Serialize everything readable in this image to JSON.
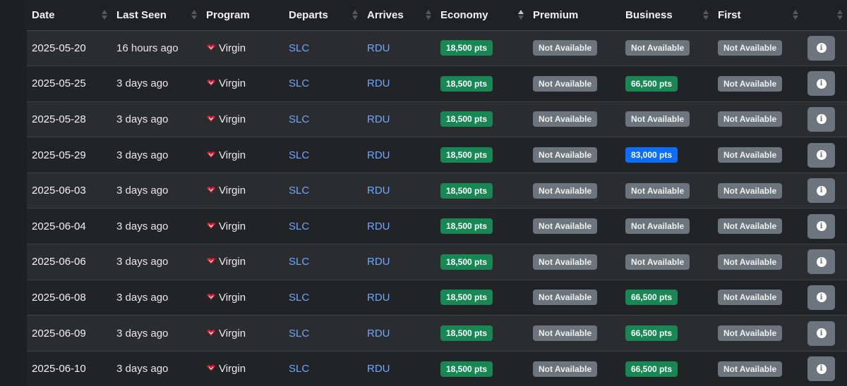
{
  "colors": {
    "available": "#198754",
    "unavailable": "#6c757d",
    "highlight": "#0d6efd",
    "airport_link": "#6ea8fe"
  },
  "columns": [
    {
      "label": "Date",
      "sortable": true,
      "sorted": null
    },
    {
      "label": "Last Seen",
      "sortable": true,
      "sorted": null
    },
    {
      "label": "Program",
      "sortable": false,
      "sorted": null
    },
    {
      "label": "Departs",
      "sortable": true,
      "sorted": null
    },
    {
      "label": "Arrives",
      "sortable": true,
      "sorted": null
    },
    {
      "label": "Economy",
      "sortable": true,
      "sorted": "asc"
    },
    {
      "label": "Premium",
      "sortable": false,
      "sorted": null
    },
    {
      "label": "Business",
      "sortable": true,
      "sorted": null
    },
    {
      "label": "First",
      "sortable": true,
      "sorted": null
    },
    {
      "label": "",
      "sortable": true,
      "sorted": null
    }
  ],
  "rows": [
    {
      "date": "2025-05-20",
      "last_seen": "16 hours ago",
      "program": "Virgin",
      "departs": "SLC",
      "arrives": "RDU",
      "economy": {
        "text": "18,500 pts",
        "style": "green"
      },
      "premium": {
        "text": "Not Available",
        "style": "grey"
      },
      "business": {
        "text": "Not Available",
        "style": "grey"
      },
      "first": {
        "text": "Not Available",
        "style": "grey"
      }
    },
    {
      "date": "2025-05-25",
      "last_seen": "3 days ago",
      "program": "Virgin",
      "departs": "SLC",
      "arrives": "RDU",
      "economy": {
        "text": "18,500 pts",
        "style": "green"
      },
      "premium": {
        "text": "Not Available",
        "style": "grey"
      },
      "business": {
        "text": "66,500 pts",
        "style": "green"
      },
      "first": {
        "text": "Not Available",
        "style": "grey"
      }
    },
    {
      "date": "2025-05-28",
      "last_seen": "3 days ago",
      "program": "Virgin",
      "departs": "SLC",
      "arrives": "RDU",
      "economy": {
        "text": "18,500 pts",
        "style": "green"
      },
      "premium": {
        "text": "Not Available",
        "style": "grey"
      },
      "business": {
        "text": "Not Available",
        "style": "grey"
      },
      "first": {
        "text": "Not Available",
        "style": "grey"
      }
    },
    {
      "date": "2025-05-29",
      "last_seen": "3 days ago",
      "program": "Virgin",
      "departs": "SLC",
      "arrives": "RDU",
      "economy": {
        "text": "18,500 pts",
        "style": "green"
      },
      "premium": {
        "text": "Not Available",
        "style": "grey"
      },
      "business": {
        "text": "83,000 pts",
        "style": "blue"
      },
      "first": {
        "text": "Not Available",
        "style": "grey"
      }
    },
    {
      "date": "2025-06-03",
      "last_seen": "3 days ago",
      "program": "Virgin",
      "departs": "SLC",
      "arrives": "RDU",
      "economy": {
        "text": "18,500 pts",
        "style": "green"
      },
      "premium": {
        "text": "Not Available",
        "style": "grey"
      },
      "business": {
        "text": "Not Available",
        "style": "grey"
      },
      "first": {
        "text": "Not Available",
        "style": "grey"
      }
    },
    {
      "date": "2025-06-04",
      "last_seen": "3 days ago",
      "program": "Virgin",
      "departs": "SLC",
      "arrives": "RDU",
      "economy": {
        "text": "18,500 pts",
        "style": "green"
      },
      "premium": {
        "text": "Not Available",
        "style": "grey"
      },
      "business": {
        "text": "Not Available",
        "style": "grey"
      },
      "first": {
        "text": "Not Available",
        "style": "grey"
      }
    },
    {
      "date": "2025-06-06",
      "last_seen": "3 days ago",
      "program": "Virgin",
      "departs": "SLC",
      "arrives": "RDU",
      "economy": {
        "text": "18,500 pts",
        "style": "green"
      },
      "premium": {
        "text": "Not Available",
        "style": "grey"
      },
      "business": {
        "text": "Not Available",
        "style": "grey"
      },
      "first": {
        "text": "Not Available",
        "style": "grey"
      }
    },
    {
      "date": "2025-06-08",
      "last_seen": "3 days ago",
      "program": "Virgin",
      "departs": "SLC",
      "arrives": "RDU",
      "economy": {
        "text": "18,500 pts",
        "style": "green"
      },
      "premium": {
        "text": "Not Available",
        "style": "grey"
      },
      "business": {
        "text": "66,500 pts",
        "style": "green"
      },
      "first": {
        "text": "Not Available",
        "style": "grey"
      }
    },
    {
      "date": "2025-06-09",
      "last_seen": "3 days ago",
      "program": "Virgin",
      "departs": "SLC",
      "arrives": "RDU",
      "economy": {
        "text": "18,500 pts",
        "style": "green"
      },
      "premium": {
        "text": "Not Available",
        "style": "grey"
      },
      "business": {
        "text": "66,500 pts",
        "style": "green"
      },
      "first": {
        "text": "Not Available",
        "style": "grey"
      }
    },
    {
      "date": "2025-06-10",
      "last_seen": "3 days ago",
      "program": "Virgin",
      "departs": "SLC",
      "arrives": "RDU",
      "economy": {
        "text": "18,500 pts",
        "style": "green"
      },
      "premium": {
        "text": "Not Available",
        "style": "grey"
      },
      "business": {
        "text": "66,500 pts",
        "style": "green"
      },
      "first": {
        "text": "Not Available",
        "style": "grey"
      }
    }
  ],
  "icons": {
    "program": "virgin-logo-icon",
    "details": "info-circle-icon",
    "sort": "sort-arrows-icon"
  }
}
